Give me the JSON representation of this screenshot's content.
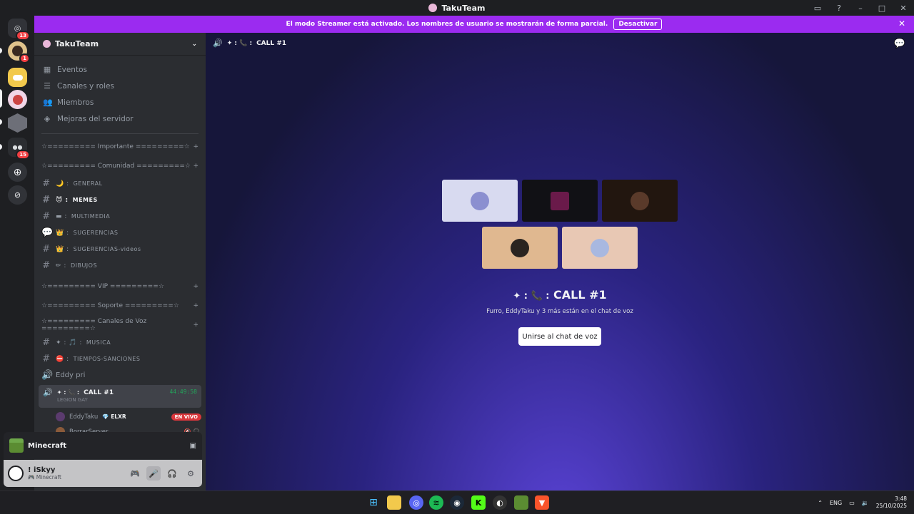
{
  "window": {
    "title": "TakuTeam"
  },
  "banner": {
    "text": "El modo Streamer está activado. Los nombres de usuario se mostrarán de forma parcial.",
    "button": "Desactivar"
  },
  "guilds": [
    {
      "badge": "13"
    },
    {
      "badge": "1"
    },
    {
      "badge": ""
    },
    {
      "badge": ""
    },
    {
      "badge": ""
    },
    {
      "badge": "15"
    }
  ],
  "sidebar": {
    "server_name": "TakuTeam",
    "menu": [
      "Eventos",
      "Canales y roles",
      "Miembros",
      "Mejoras del servidor"
    ],
    "categories": {
      "importante": "☆========= Importante =========☆",
      "comunidad": "☆========= Comunidad =========☆",
      "vip": "☆========= VIP =========☆",
      "soporte": "☆========= Soporte =========☆",
      "voz": "☆========= Canales de Voz =========☆"
    },
    "channels": {
      "general": "GENERAL",
      "memes": "MEMES",
      "multimedia": "MULTIMEDIA",
      "sugerencias": "SUGERENCIAS",
      "sugerencias_videos": "SUGERENCIAS-videos",
      "dibujos": "DIBUJOS",
      "musica": "MUSICA",
      "tiempos": "TIEMPOS-SANCIONES",
      "eddy": "Eddy pri"
    },
    "voice": {
      "name": "CALL #1",
      "subtitle": "LEGION GAY",
      "timer": "44:49:58",
      "users": [
        {
          "name": "EddyTaku",
          "tag": "ELXR",
          "live": "EN VIVO"
        },
        {
          "name": "BorrarServer"
        }
      ]
    }
  },
  "activity": {
    "game": "Minecraft"
  },
  "user": {
    "name": "! iSkyy",
    "status": "Minecraft"
  },
  "main": {
    "header_name": "CALL #1",
    "call_title": "CALL #1",
    "call_subtitle": "Furro, EddyTaku y 3 más están en el chat de voz",
    "join_button": "Unirse al chat de voz"
  },
  "taskbar": {
    "lang": "ENG",
    "time": "3:48",
    "date": "25/10/2025"
  },
  "colors": {
    "accent": "#9b2bf0",
    "green": "#23a55a",
    "red": "#da373c"
  }
}
